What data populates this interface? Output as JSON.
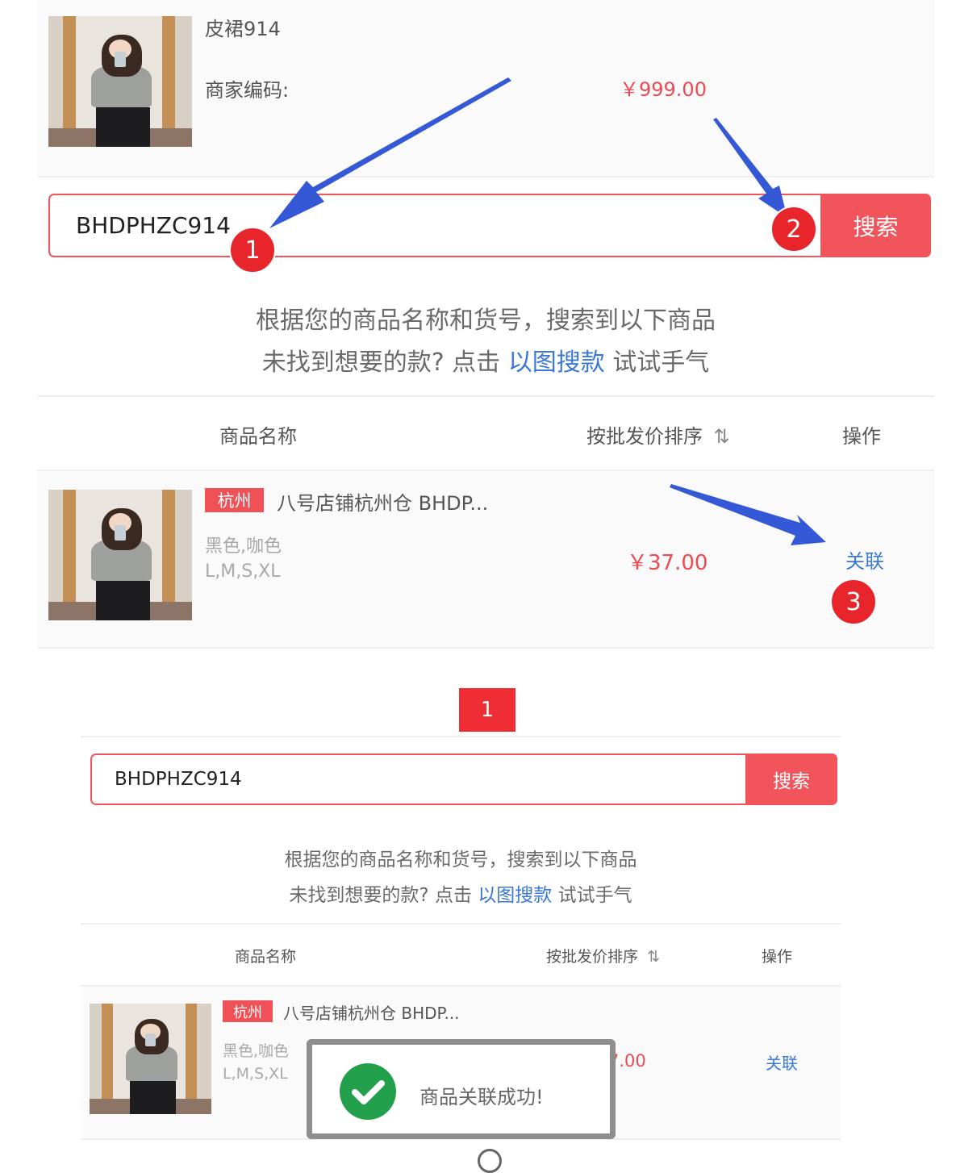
{
  "product": {
    "name": "皮裙914",
    "merchant_code_label": "商家编码:",
    "price": "￥999.00"
  },
  "search": {
    "value": "BHDPHZC914",
    "button_label": "搜索"
  },
  "hint": {
    "line1": "根据您的商品名称和货号，搜索到以下商品",
    "line2_prefix": "未找到想要的款? 点击",
    "line2_link": "以图搜款",
    "line2_suffix": "试试手气"
  },
  "table": {
    "col_name": "商品名称",
    "col_sort": "按批发价排序",
    "sort_icon": "⇅",
    "col_action": "操作"
  },
  "result": {
    "tag": "杭州",
    "title": "八号店铺杭州仓 BHDP...",
    "colors": "黑色,咖色",
    "sizes": "L,M,S,XL",
    "price": "￥37.00",
    "action": "关联"
  },
  "annotations": {
    "step1": "1",
    "step2": "2",
    "step3": "3",
    "step_box": "1",
    "arrow_color": "#3558d6",
    "badge_color": "#e8252a"
  },
  "bottom_result_price_partial": "7.00",
  "toast": {
    "message": "商品关联成功!"
  },
  "colors": {
    "accent_red": "#f2545b",
    "link_blue": "#3a78d8",
    "success_green": "#22a04b"
  }
}
